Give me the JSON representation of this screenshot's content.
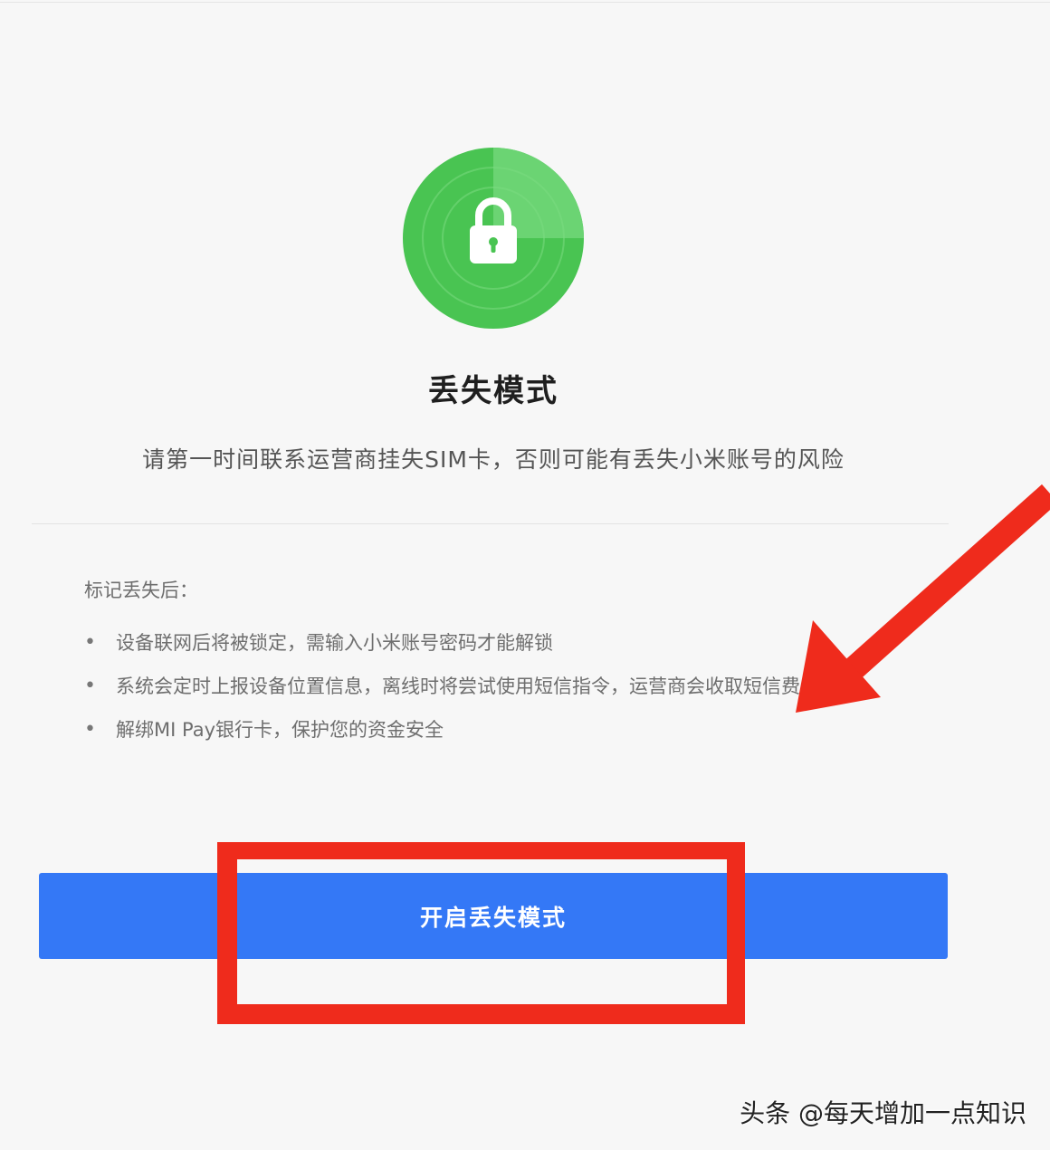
{
  "badge": {
    "icon": "lock-icon",
    "colors": {
      "outer_circle": "#52c95a",
      "inner_ring": "#6fd676",
      "lock": "#ffffff"
    }
  },
  "page": {
    "title": "丢失模式",
    "warning": "请第一时间联系运营商挂失SIM卡，否则可能有丢失小米账号的风险"
  },
  "info": {
    "heading": "标记丢失后：",
    "items": [
      "设备联网后将被锁定，需输入小米账号密码才能解锁",
      "系统会定时上报设备位置信息，离线时将尝试使用短信指令，运营商会收取短信费用",
      "解绑MI Pay银行卡，保护您的资金安全"
    ]
  },
  "actions": {
    "enable_lost_mode_label": "开启丢失模式",
    "button_color": "#3478f6"
  },
  "annotation": {
    "highlight_color": "#ef2b1c"
  },
  "watermark": {
    "text": "头条 @每天增加一点知识"
  }
}
